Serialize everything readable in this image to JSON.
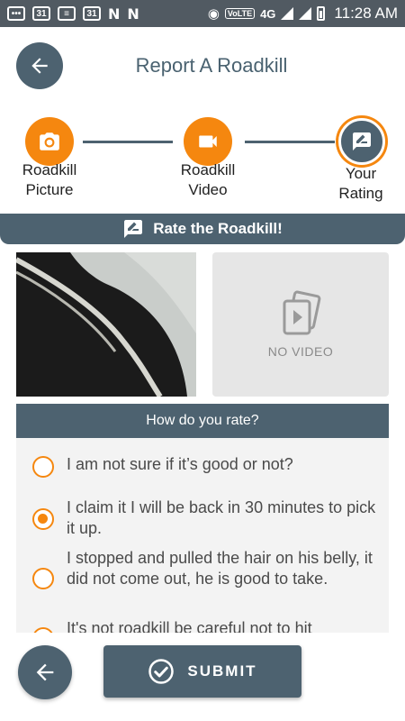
{
  "status_bar": {
    "calendar_day_1": "31",
    "calendar_day_2": "31",
    "n_icon_1": "N",
    "n_icon_2": "N",
    "volte": "VoLTE",
    "network": "4G",
    "time": "11:28 AM"
  },
  "header": {
    "title": "Report A Roadkill"
  },
  "steps": [
    {
      "label_line1": "Roadkill",
      "label_line2": "Picture",
      "icon": "camera-icon",
      "active": false
    },
    {
      "label_line1": "Roadkill",
      "label_line2": "Video",
      "icon": "video-camera-icon",
      "active": false
    },
    {
      "label_line1": "Your",
      "label_line2": "Rating",
      "icon": "rate-review-icon",
      "active": true
    }
  ],
  "rate_bar": {
    "label": "Rate the Roadkill!"
  },
  "media": {
    "no_video_label": "NO VIDEO"
  },
  "rating_card": {
    "heading": "How do you rate?",
    "options": [
      {
        "text": "I am not sure if it’s good or not?",
        "selected": false
      },
      {
        "text": "I claim it I will be back in 30 minutes to pick it up.",
        "selected": true
      },
      {
        "text": "I stopped and pulled the hair on his belly, it did not come out, he is good to take.",
        "selected": false
      },
      {
        "text": "It's not roadkill be careful not to hit",
        "selected": false
      }
    ]
  },
  "footer": {
    "submit_label": "SUBMIT"
  },
  "colors": {
    "accent": "#f5870f",
    "primary": "#4d6270",
    "statusbar": "#515a62"
  }
}
